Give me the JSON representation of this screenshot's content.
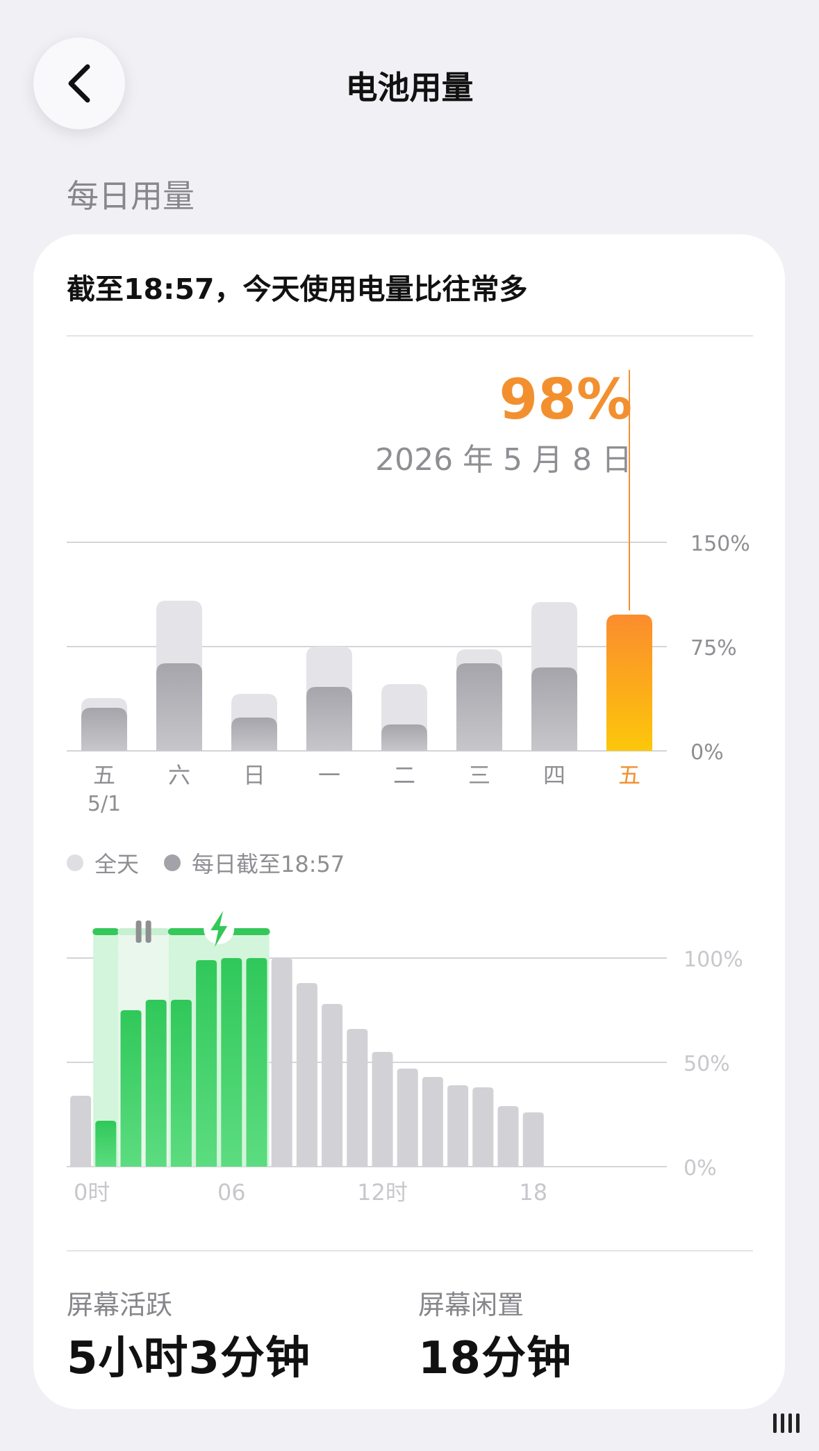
{
  "header": {
    "title": "电池用量",
    "back_icon": "chevron-left-icon"
  },
  "section_label": "每日用量",
  "summary": "截至18:57，今天使用电量比往常多",
  "highlight": {
    "value": "98%",
    "date": "2026 年 5 月 8 日",
    "color": "#f2902f"
  },
  "colors": {
    "accent": "#f2902f",
    "full_day_bar": "#e3e3e8",
    "partial_bar": "#aeaeb4",
    "charging_green": "#34c759",
    "charging_band": "#d3f5db",
    "hour_bar": "#d1d1d6",
    "grid": "#cfcfd4",
    "axis_text": "#8e8e93"
  },
  "legend": {
    "full_day": "全天",
    "partial": "每日截至18:57"
  },
  "chart_data": [
    {
      "type": "bar",
      "title": "",
      "ylim": [
        0,
        150
      ],
      "y_ticks": [
        "150%",
        "75%",
        "0%"
      ],
      "categories": [
        "五",
        "六",
        "日",
        "一",
        "二",
        "三",
        "四",
        "五"
      ],
      "category_sublabels": [
        "5/1",
        "",
        "",
        "",
        "",
        "",
        "",
        ""
      ],
      "highlighted_index": 7,
      "series": [
        {
          "name": "全天",
          "values": [
            38,
            108,
            41,
            75,
            48,
            73,
            107,
            null
          ]
        },
        {
          "name": "每日截至18:57",
          "values": [
            31,
            63,
            24,
            46,
            19,
            63,
            60,
            98
          ]
        }
      ],
      "grid": true
    },
    {
      "type": "bar",
      "title": "",
      "ylim": [
        0,
        100
      ],
      "y_ticks": [
        "100%",
        "50%",
        "0%"
      ],
      "x_ticks": [
        "0时",
        "06",
        "12时",
        "18"
      ],
      "x_tick_hours": [
        0,
        6,
        12,
        18
      ],
      "hours": [
        0,
        1,
        2,
        3,
        4,
        5,
        6,
        7,
        8,
        9,
        10,
        11,
        12,
        13,
        14,
        15,
        16,
        17,
        18
      ],
      "values": [
        34,
        22,
        75,
        80,
        80,
        99,
        100,
        100,
        100,
        88,
        78,
        66,
        55,
        47,
        43,
        39,
        38,
        29,
        26
      ],
      "charging_hours": [
        1,
        2,
        3,
        4,
        5,
        6,
        7
      ],
      "charging_segments": [
        {
          "from_hour": 1,
          "to_hour": 2,
          "icon": ""
        },
        {
          "from_hour": 2,
          "to_hour": 4,
          "icon": "pause-icon"
        },
        {
          "from_hour": 4,
          "to_hour": 8,
          "icon": "lightning-icon"
        }
      ],
      "grid": true
    }
  ],
  "stats": [
    {
      "label": "屏幕活跃",
      "value": "5小时3分钟"
    },
    {
      "label": "屏幕闲置",
      "value": "18分钟"
    }
  ]
}
